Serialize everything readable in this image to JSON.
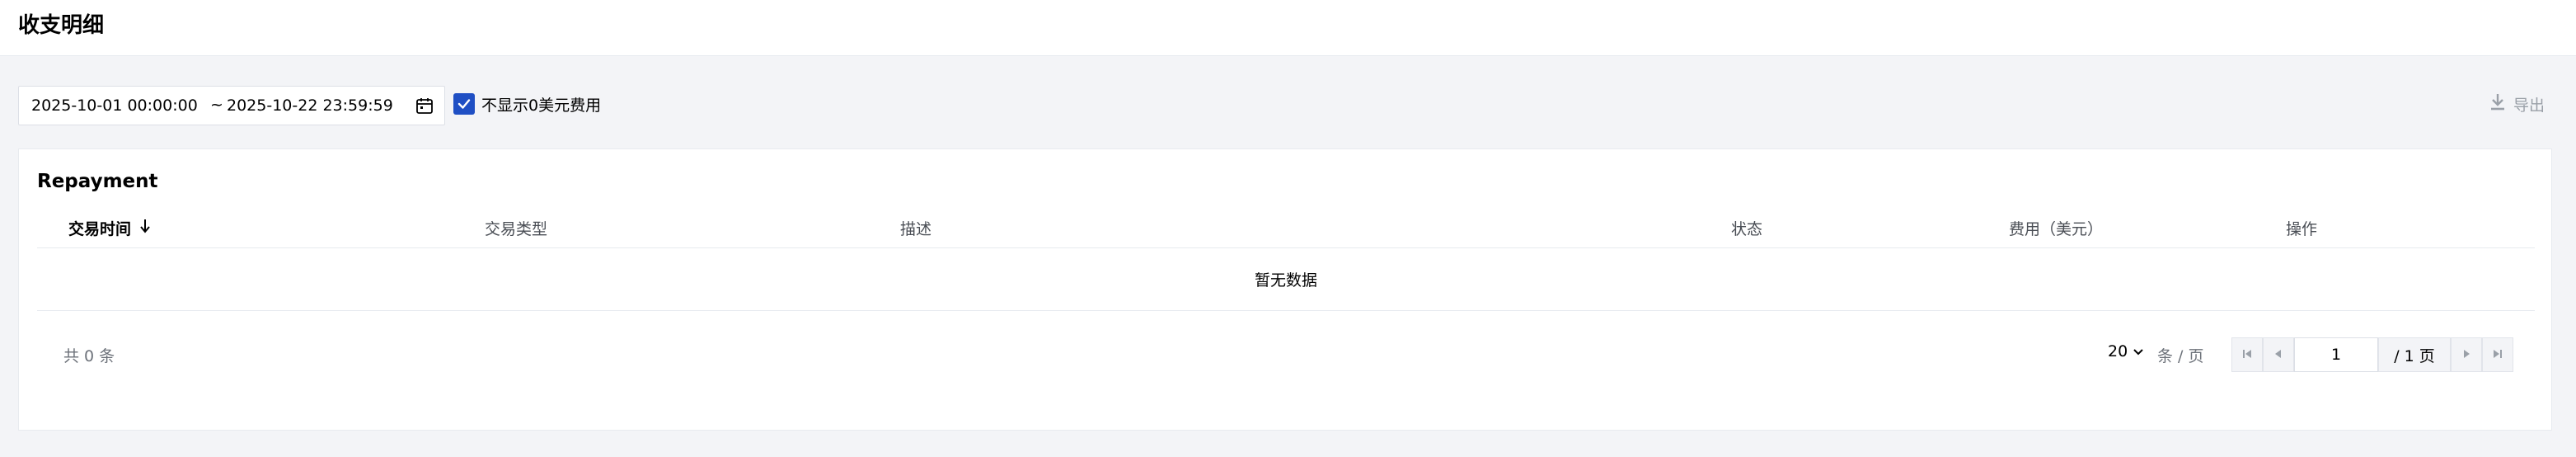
{
  "header": {
    "title": "收支明细"
  },
  "toolbar": {
    "date_start": "2025-10-01 00:00:00",
    "date_separator": "~",
    "date_end": "2025-10-22 23:59:59",
    "hide_zero_label": "不显示0美元费用",
    "hide_zero_checked": true,
    "export_label": "导出"
  },
  "card": {
    "title": "Repayment",
    "columns": [
      "交易时间",
      "交易类型",
      "描述",
      "状态",
      "费用（美元）",
      "操作"
    ],
    "sort_column": "交易时间",
    "sort_direction": "desc",
    "empty_text": "暂无数据"
  },
  "pagination": {
    "total_text": "共 0 条",
    "page_size": "20",
    "page_size_unit": "条 / 页",
    "current_page": "1",
    "total_pages_text": "/ 1 页"
  },
  "colors": {
    "accent": "#1f4fc4",
    "page_background": "#f3f4f7",
    "muted_text": "#6d727a",
    "disabled_text": "#9aa0a8"
  }
}
